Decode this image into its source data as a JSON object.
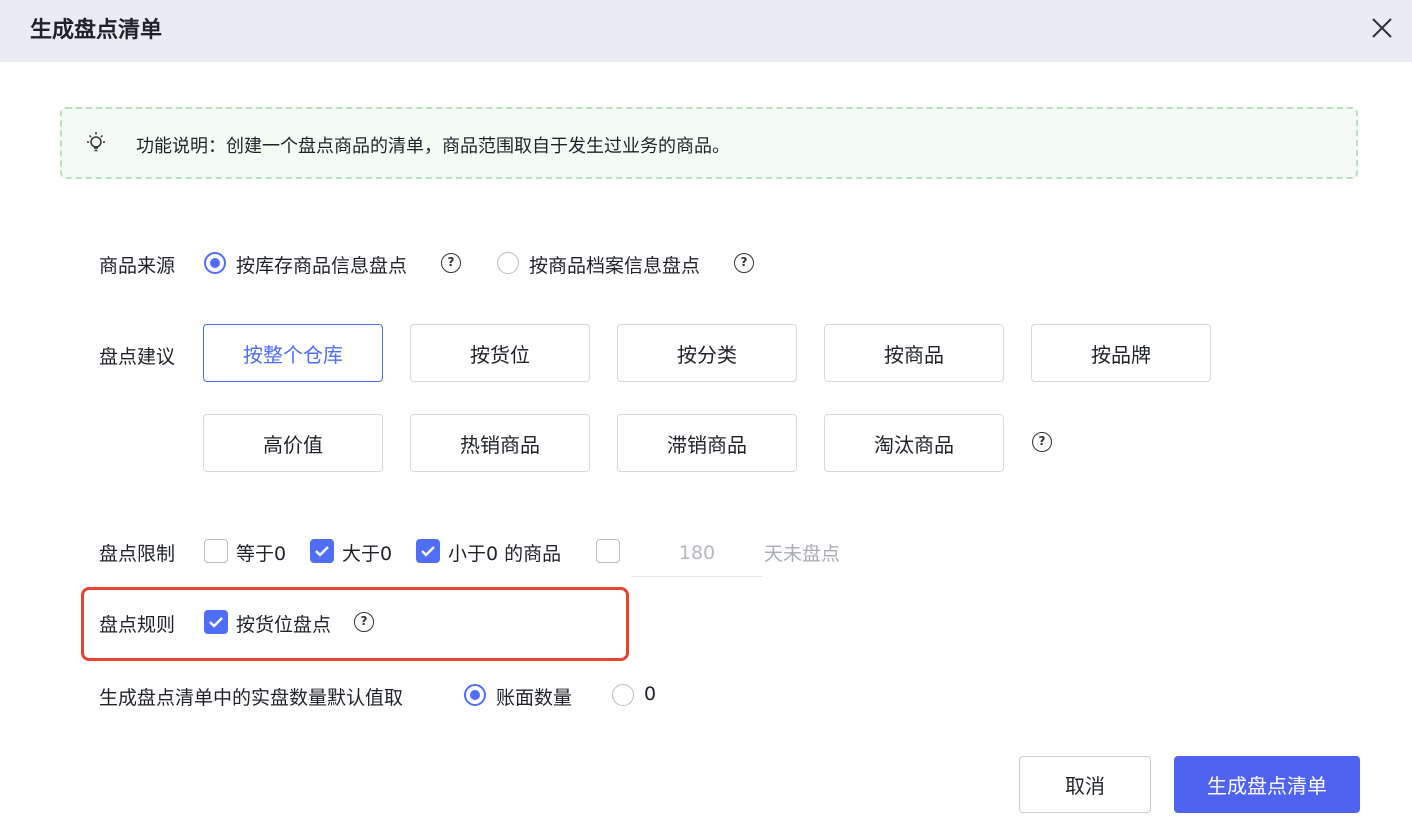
{
  "dialog": {
    "title": "生成盘点清单"
  },
  "tip": {
    "text": "功能说明：创建一个盘点商品的清单，商品范围取自于发生过业务的商品。"
  },
  "source": {
    "label": "商品来源",
    "options": [
      {
        "label": "按库存商品信息盘点",
        "checked": true
      },
      {
        "label": "按商品档案信息盘点",
        "checked": false
      }
    ]
  },
  "suggestion": {
    "label": "盘点建议",
    "chips": [
      "按整个仓库",
      "按货位",
      "按分类",
      "按商品",
      "按品牌",
      "高价值",
      "热销商品",
      "滞销商品",
      "淘汰商品"
    ],
    "active": "按整个仓库"
  },
  "limit": {
    "label": "盘点限制",
    "eq_zero": "等于0",
    "gt_zero": "大于0",
    "lt_zero": "小于0 的商品",
    "days_value": "180",
    "days_suffix": "天未盘点"
  },
  "rule": {
    "label": "盘点规则",
    "option": "按货位盘点"
  },
  "default_qty": {
    "label": "生成盘点清单中的实盘数量默认值取",
    "options": [
      {
        "label": "账面数量",
        "checked": true
      },
      {
        "label": "0",
        "checked": false
      }
    ]
  },
  "footer": {
    "cancel": "取消",
    "confirm": "生成盘点清单"
  },
  "colors": {
    "accent": "#4f6df5",
    "primary_button": "#4f63f0",
    "highlight_border": "#e8432e",
    "tip_border": "#b7e1bd"
  }
}
